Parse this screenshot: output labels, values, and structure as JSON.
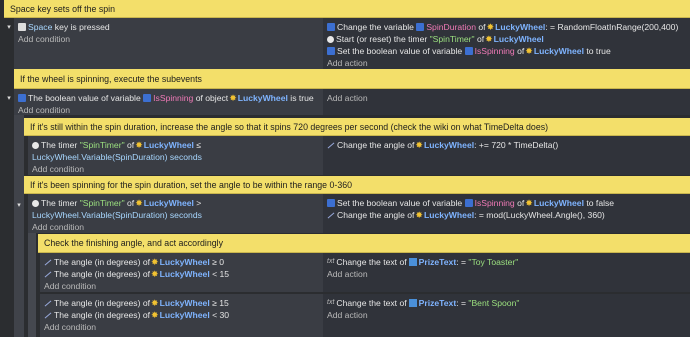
{
  "events": {
    "c1": "Space key sets off the spin",
    "e1": {
      "cond_key": "Space",
      "cond_text": "key is pressed",
      "add_condition": "Add condition",
      "a1_pre": "Change the variable",
      "a1_var": "SpinDuration",
      "a1_of": "of",
      "a1_obj": "LuckyWheel",
      "a1_post": ": = RandomFloatInRange(200,400)",
      "a2_pre": "Start (or reset) the timer",
      "a2_str": "\"SpinTimer\"",
      "a2_of": "of",
      "a2_obj": "LuckyWheel",
      "a3_pre": "Set the boolean value of variable",
      "a3_var": "IsSpinning",
      "a3_of": "of",
      "a3_obj": "LuckyWheel",
      "a3_post": "to true",
      "add_action": "Add action"
    },
    "c2": "If the wheel is spinning, execute the subevents",
    "e2": {
      "cond_pre": "The boolean value of variable",
      "cond_var": "IsSpinning",
      "cond_of": "of object",
      "cond_obj": "LuckyWheel",
      "cond_post": "is true",
      "add_condition": "Add condition",
      "add_action": "Add action"
    },
    "c3": "If it's still within the spin duration, increase the angle so that it spins 720 degrees per second (check the wiki on what TimeDelta does)",
    "e3": {
      "cond_pre": "The timer",
      "cond_str": "\"SpinTimer\"",
      "cond_of": "of",
      "cond_obj": "LuckyWheel",
      "cond_op": "≤",
      "cond_line2": "LuckyWheel.Variable(SpinDuration) seconds",
      "add_condition": "Add condition",
      "a1_pre": "Change the angle of",
      "a1_obj": "LuckyWheel",
      "a1_post": ": += 720 * TimeDelta()"
    },
    "c4": "If it's been spinning for the spin duration, set the angle to be within the range 0-360",
    "e4": {
      "cond_pre": "The timer",
      "cond_str": "\"SpinTimer\"",
      "cond_of": "of",
      "cond_obj": "LuckyWheel",
      "cond_op": ">",
      "cond_line2": "LuckyWheel.Variable(SpinDuration) seconds",
      "add_condition": "Add condition",
      "a1_pre": "Set the boolean value of variable",
      "a1_var": "IsSpinning",
      "a1_of": "of",
      "a1_obj": "LuckyWheel",
      "a1_post": "to false",
      "a2_pre": "Change the angle of",
      "a2_obj": "LuckyWheel",
      "a2_post": ": = mod(LuckyWheel.Angle(), 360)"
    },
    "c5": "Check the finishing angle, and act accordingly",
    "e5": {
      "c1_pre": "The angle (in degrees) of",
      "c1_obj": "LuckyWheel",
      "c1_post": "≥  0",
      "c2_pre": "The angle (in degrees) of",
      "c2_obj": "LuckyWheel",
      "c2_post": "<  15",
      "add_condition": "Add condition",
      "a1_pre": "Change the text of",
      "a1_obj": "PrizeText",
      "a1_mid": ": =",
      "a1_str": "\"Toy Toaster\"",
      "add_action": "Add action"
    },
    "e6": {
      "c1_pre": "The angle (in degrees) of",
      "c1_obj": "LuckyWheel",
      "c1_post": "≥  15",
      "c2_pre": "The angle (in degrees) of",
      "c2_obj": "LuckyWheel",
      "c2_post": "<  30",
      "add_condition": "Add condition",
      "a1_pre": "Change the text of",
      "a1_obj": "PrizeText",
      "a1_mid": ": =",
      "a1_str": "\"Bent Spoon\"",
      "add_action": "Add action"
    }
  }
}
